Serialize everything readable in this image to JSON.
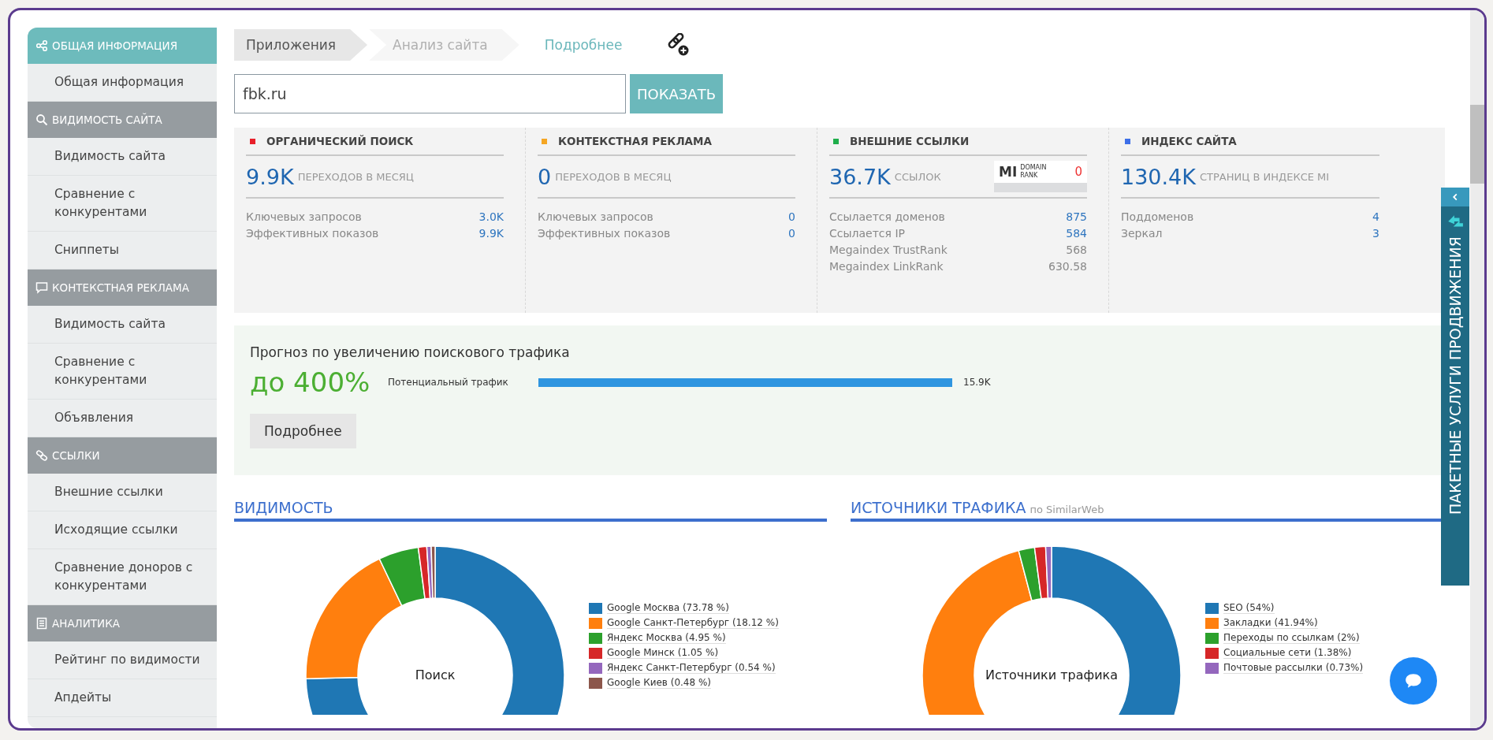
{
  "sidebar": {
    "groups": [
      {
        "title": "ОБЩАЯ ИНФОРМАЦИЯ",
        "selected": true,
        "items": [
          "Общая информация"
        ]
      },
      {
        "title": "ВИДИМОСТЬ САЙТА",
        "selected": false,
        "items": [
          "Видимость сайта",
          "Сравнение с конкурентами",
          "Сниппеты"
        ]
      },
      {
        "title": "КОНТЕКСТНАЯ РЕКЛАМА",
        "selected": false,
        "items": [
          "Видимость сайта",
          "Сравнение с конкурентами",
          "Объявления"
        ]
      },
      {
        "title": "ССЫЛКИ",
        "selected": false,
        "items": [
          "Внешние ссылки",
          "Исходящие ссылки",
          "Сравнение доноров с конкурентами"
        ]
      },
      {
        "title": "АНАЛИТИКА",
        "selected": false,
        "items": [
          "Рейтинг по видимости",
          "Апдейты"
        ]
      }
    ]
  },
  "breadcrumbs": [
    {
      "label": "Приложения",
      "kind": "root"
    },
    {
      "label": "Анализ сайта",
      "kind": "step"
    },
    {
      "label": "Подробнее",
      "kind": "current"
    }
  ],
  "search": {
    "value": "fbk.ru",
    "button": "ПОКАЗАТЬ"
  },
  "cards": [
    {
      "title": "ОРГАНИЧЕСКИЙ ПОИСК",
      "color": "#e8202a",
      "value": "9.9K",
      "unit": "ПЕРЕХОДОВ В МЕСЯЦ",
      "rows": [
        {
          "label": "Ключевых запросов",
          "value": "3.0K",
          "linked": true
        },
        {
          "label": "Эффективных показов",
          "value": "9.9K",
          "linked": true
        }
      ]
    },
    {
      "title": "КОНТЕКСТНАЯ РЕКЛАМА",
      "color": "#f5a623",
      "value": "0",
      "unit": "ПЕРЕХОДОВ В МЕСЯЦ",
      "rows": [
        {
          "label": "Ключевых запросов",
          "value": "0",
          "linked": true
        },
        {
          "label": "Эффективных показов",
          "value": "0",
          "linked": true
        }
      ]
    },
    {
      "title": "ВНЕШНИЕ ССЫЛКИ",
      "color": "#1fae4b",
      "value": "36.7K",
      "unit": "ССЫЛОК",
      "badge": {
        "logo": "MI",
        "line_1": "DOMAIN",
        "line_2": "RANK",
        "value": "0"
      },
      "rows": [
        {
          "label": "Ссылается доменов",
          "value": "875",
          "linked": true
        },
        {
          "label": "Ссылается IP",
          "value": "584",
          "linked": true
        },
        {
          "label": "Megaindex TrustRank",
          "value": "568",
          "linked": false
        },
        {
          "label": "Megaindex LinkRank",
          "value": "630.58",
          "linked": false
        }
      ]
    },
    {
      "title": "ИНДЕКС САЙТА",
      "color": "#3d6fe8",
      "value": "130.4K",
      "unit": "СТРАНИЦ В ИНДЕКСЕ MI",
      "rows": [
        {
          "label": "Поддоменов",
          "value": "4",
          "linked": true
        },
        {
          "label": "Зеркал",
          "value": "3",
          "linked": true
        }
      ]
    }
  ],
  "forecast": {
    "title": "Прогноз по увеличению поискового трафика",
    "value": "до 400%",
    "bar_label": "Потенциальный трафик",
    "level": 1,
    "reading": "15.9K",
    "button": "Подробнее"
  },
  "charts": [
    {
      "heading": "ВИДИМОСТЬ",
      "legend": [
        {
          "label": "Google Москва (73.78 %)",
          "color": "#1f77b4"
        },
        {
          "label": "Google Санкт-Петербург (18.12 %)",
          "color": "#ff7f0e"
        },
        {
          "label": "Яндекс Москва (4.95 %)",
          "color": "#2ca02c"
        },
        {
          "label": "Google Минск (1.05 %)",
          "color": "#d62728"
        },
        {
          "label": "Яндекс Санкт-Петербург (0.54 %)",
          "color": "#9467bd"
        },
        {
          "label": "Google Киев (0.48 %)",
          "color": "#8c564b"
        }
      ],
      "chart_data": {
        "type": "donut",
        "title": "Поиск",
        "values": [
          73.78,
          18.12,
          4.95,
          1.05,
          0.54,
          0.48
        ]
      }
    },
    {
      "heading": "ИСТОЧНИКИ ТРАФИКА",
      "subheading": "по SimilarWeb",
      "legend": [
        {
          "label": "SEO (54%)",
          "color": "#1f77b4"
        },
        {
          "label": "Закладки (41.94%)",
          "color": "#ff7f0e"
        },
        {
          "label": "Переходы по ссылкам (2%)",
          "color": "#2ca02c"
        },
        {
          "label": "Социальные сети (1.38%)",
          "color": "#d62728"
        },
        {
          "label": "Почтовые рассылки (0.73%)",
          "color": "#9467bd"
        }
      ],
      "chart_data": {
        "type": "donut",
        "title": "Источники трафика",
        "values": [
          54,
          41.94,
          2,
          1.38,
          0.73
        ]
      }
    }
  ],
  "side_tab": {
    "label": "ПАКЕТНЫЕ УСЛУГИ ПРОДВИЖЕНИЯ"
  }
}
